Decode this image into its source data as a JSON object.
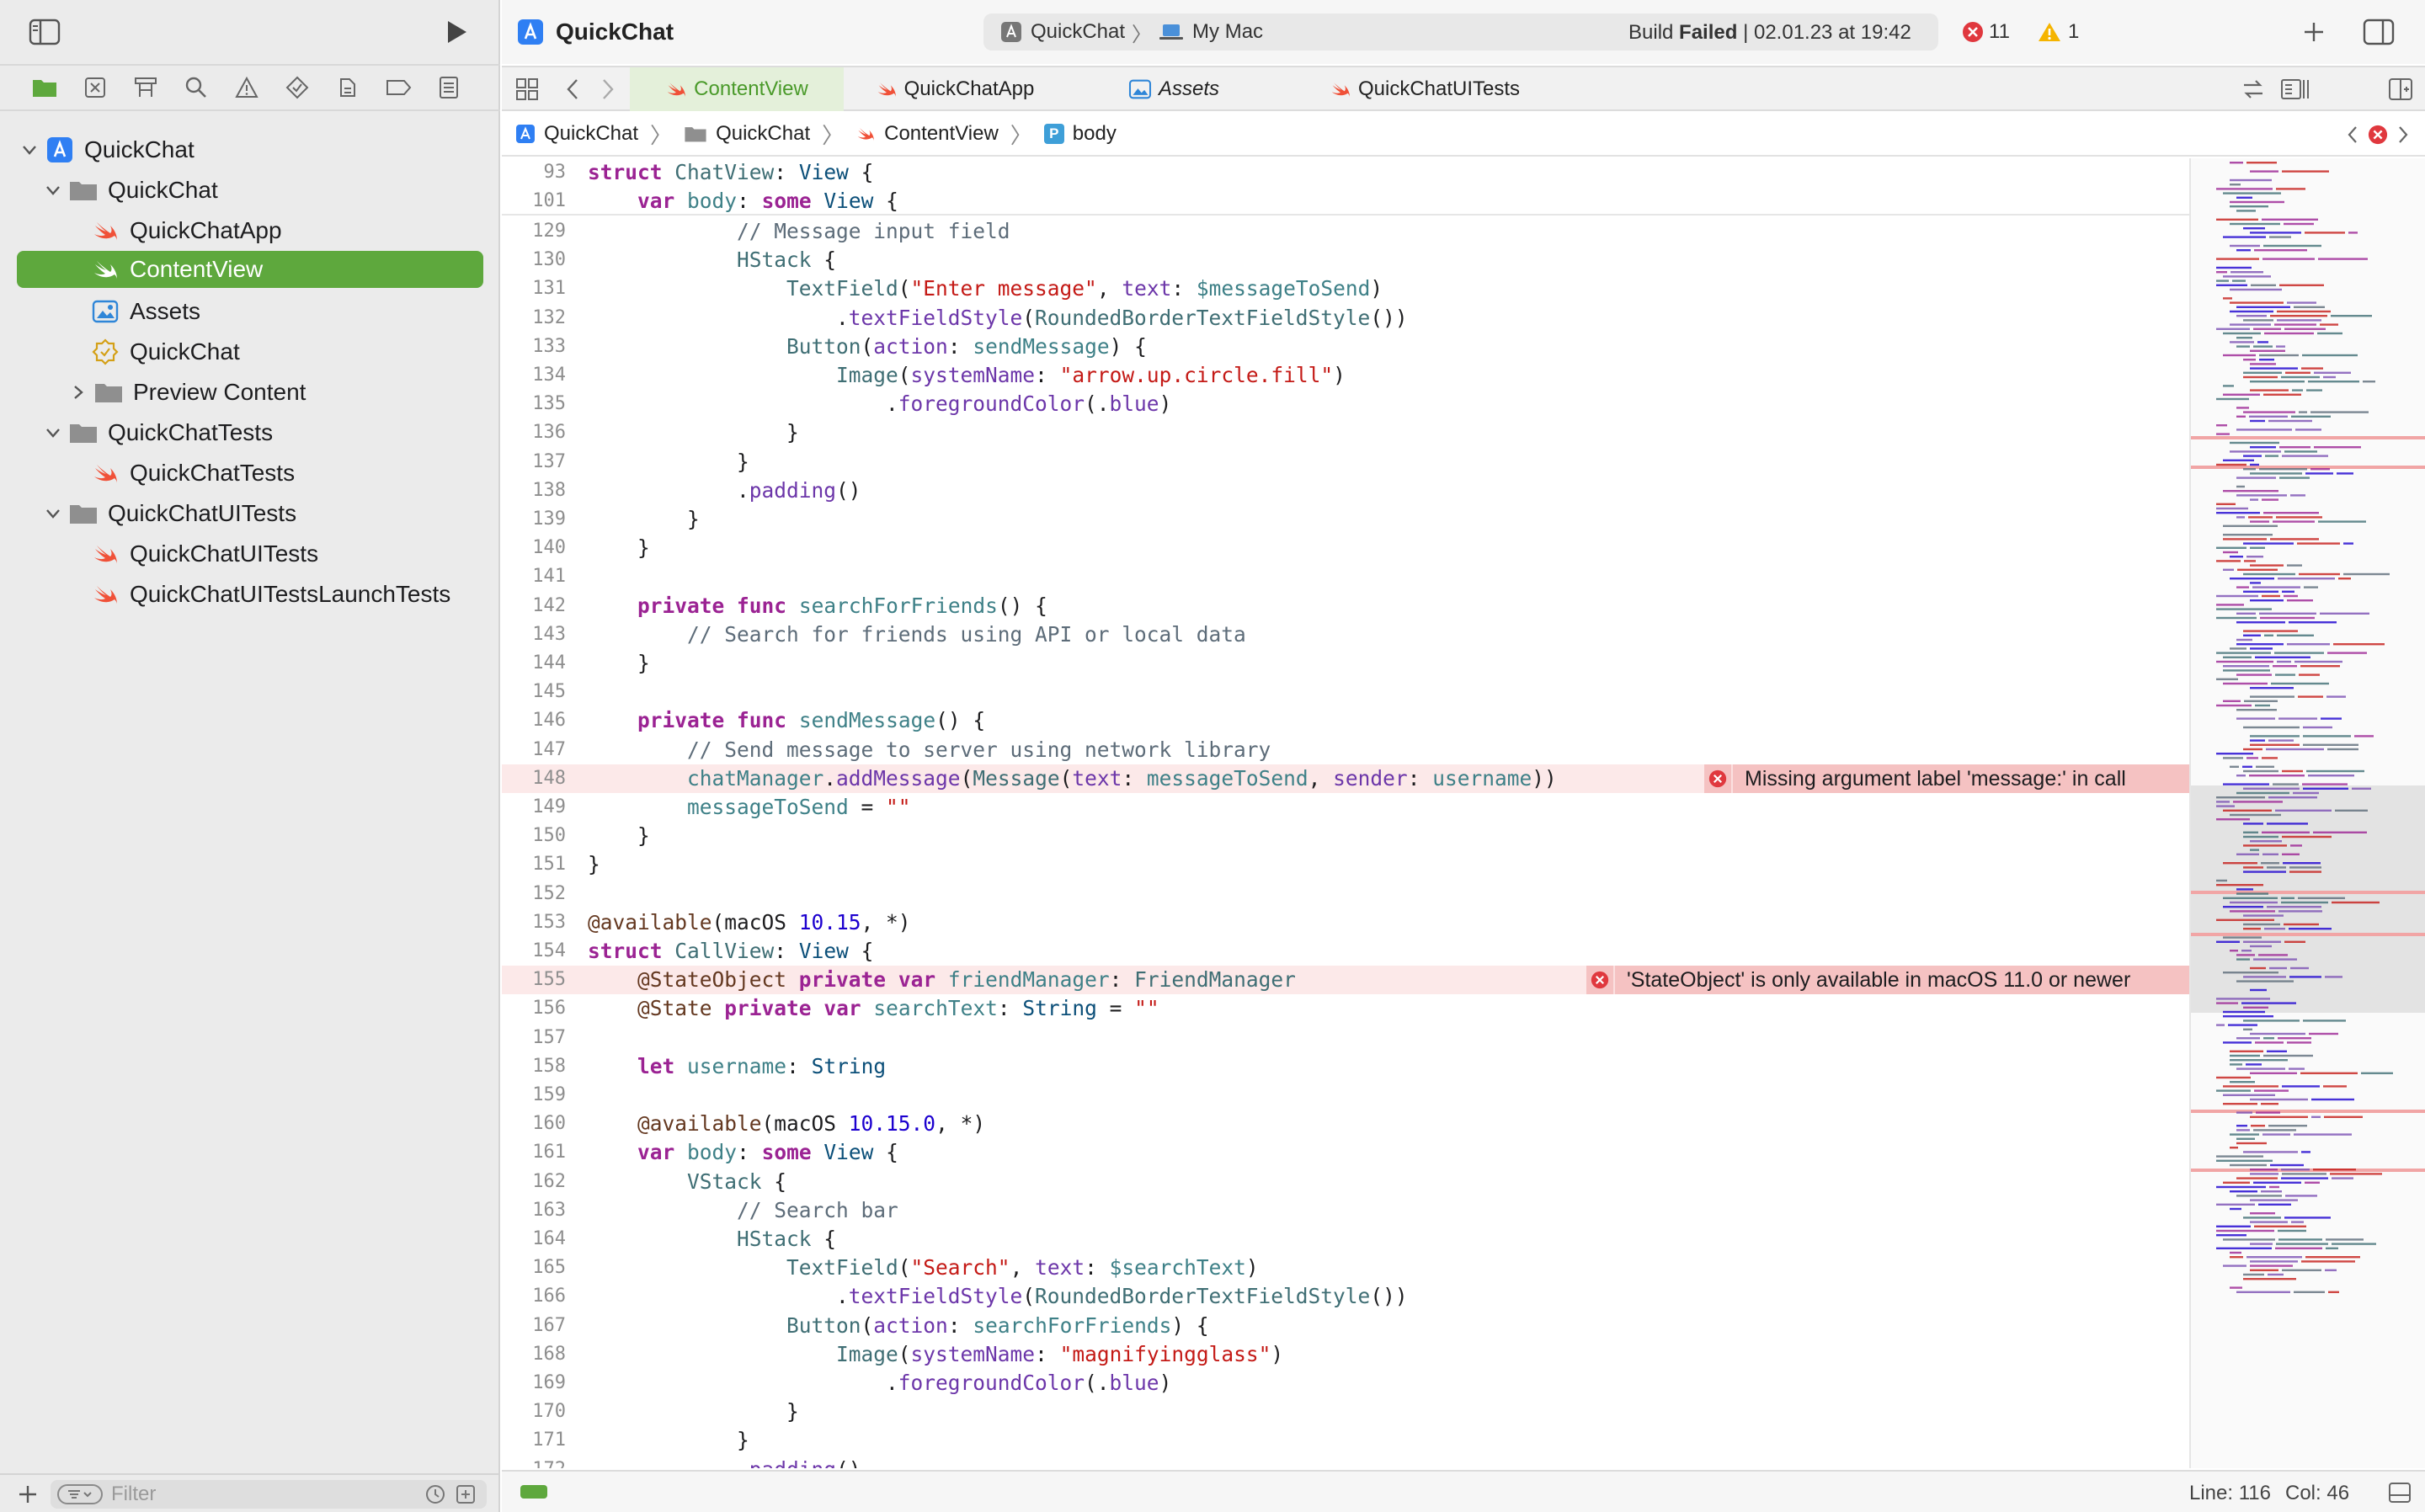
{
  "window": {
    "title": "QuickChat"
  },
  "scheme": {
    "project": "QuickChat",
    "destination": "My Mac",
    "build_prefix": "Build",
    "build_result": "Failed",
    "build_time": "| 02.01.23 at 19:42",
    "errors": "11",
    "warnings": "1"
  },
  "tabs": [
    {
      "label": "ContentView",
      "active": true
    },
    {
      "label": "QuickChatApp",
      "active": false
    },
    {
      "label": "Assets",
      "active": false
    },
    {
      "label": "QuickChatUITests",
      "active": false
    }
  ],
  "breadcrumb": [
    "QuickChat",
    "QuickChat",
    "ContentView",
    "body"
  ],
  "navigator": {
    "items": [
      {
        "label": "QuickChat",
        "kind": "project"
      },
      {
        "label": "QuickChat",
        "kind": "folder"
      },
      {
        "label": "QuickChatApp",
        "kind": "swift"
      },
      {
        "label": "ContentView",
        "kind": "swift",
        "selected": true
      },
      {
        "label": "Assets",
        "kind": "assets"
      },
      {
        "label": "QuickChat",
        "kind": "entitlements"
      },
      {
        "label": "Preview Content",
        "kind": "folder"
      },
      {
        "label": "QuickChatTests",
        "kind": "folder"
      },
      {
        "label": "QuickChatTests",
        "kind": "swift"
      },
      {
        "label": "QuickChatUITests",
        "kind": "folder"
      },
      {
        "label": "QuickChatUITests",
        "kind": "swift"
      },
      {
        "label": "QuickChatUITestsLaunchTests",
        "kind": "swift"
      }
    ],
    "filter_placeholder": "Filter"
  },
  "sticky": [
    {
      "n": "93",
      "text": "struct ChatView: View {"
    },
    {
      "n": "101",
      "text": "    var body: some View {"
    }
  ],
  "code": [
    {
      "n": "129",
      "text": "            // Message input field"
    },
    {
      "n": "130",
      "text": "            HStack {"
    },
    {
      "n": "131",
      "text": "                TextField(\"Enter message\", text: $messageToSend)"
    },
    {
      "n": "132",
      "text": "                    .textFieldStyle(RoundedBorderTextFieldStyle())"
    },
    {
      "n": "133",
      "text": "                Button(action: sendMessage) {"
    },
    {
      "n": "134",
      "text": "                    Image(systemName: \"arrow.up.circle.fill\")"
    },
    {
      "n": "135",
      "text": "                        .foregroundColor(.blue)"
    },
    {
      "n": "136",
      "text": "                }"
    },
    {
      "n": "137",
      "text": "            }"
    },
    {
      "n": "138",
      "text": "            .padding()"
    },
    {
      "n": "139",
      "text": "        }"
    },
    {
      "n": "140",
      "text": "    }"
    },
    {
      "n": "141",
      "text": ""
    },
    {
      "n": "142",
      "text": "    private func searchForFriends() {"
    },
    {
      "n": "143",
      "text": "        // Search for friends using API or local data"
    },
    {
      "n": "144",
      "text": "    }"
    },
    {
      "n": "145",
      "text": ""
    },
    {
      "n": "146",
      "text": "    private func sendMessage() {"
    },
    {
      "n": "147",
      "text": "        // Send message to server using network library"
    },
    {
      "n": "148",
      "text": "        chatManager.addMessage(Message(text: messageToSend, sender: username))"
    },
    {
      "n": "149",
      "text": "        messageToSend = \"\""
    },
    {
      "n": "150",
      "text": "    }"
    },
    {
      "n": "151",
      "text": "}"
    },
    {
      "n": "152",
      "text": ""
    },
    {
      "n": "153",
      "text": "@available(macOS 10.15, *)"
    },
    {
      "n": "154",
      "text": "struct CallView: View {"
    },
    {
      "n": "155",
      "text": "    @StateObject private var friendManager: FriendManager"
    },
    {
      "n": "156",
      "text": "    @State private var searchText: String = \"\""
    },
    {
      "n": "157",
      "text": ""
    },
    {
      "n": "158",
      "text": "    let username: String"
    },
    {
      "n": "159",
      "text": ""
    },
    {
      "n": "160",
      "text": "    @available(macOS 10.15.0, *)"
    },
    {
      "n": "161",
      "text": "    var body: some View {"
    },
    {
      "n": "162",
      "text": "        VStack {"
    },
    {
      "n": "163",
      "text": "            // Search bar"
    },
    {
      "n": "164",
      "text": "            HStack {"
    },
    {
      "n": "165",
      "text": "                TextField(\"Search\", text: $searchText)"
    },
    {
      "n": "166",
      "text": "                    .textFieldStyle(RoundedBorderTextFieldStyle())"
    },
    {
      "n": "167",
      "text": "                Button(action: searchForFriends) {"
    },
    {
      "n": "168",
      "text": "                    Image(systemName: \"magnifyingglass\")"
    },
    {
      "n": "169",
      "text": "                        .foregroundColor(.blue)"
    },
    {
      "n": "170",
      "text": "                }"
    },
    {
      "n": "171",
      "text": "            }"
    },
    {
      "n": "172",
      "text": "            .padding()"
    }
  ],
  "errors": [
    {
      "line": "148",
      "message": "Missing argument label 'message:' in call"
    },
    {
      "line": "155",
      "message": "'StateObject' is only available in macOS 11.0 or newer"
    }
  ],
  "status": {
    "line": "Line: 116",
    "col": "Col: 46"
  },
  "colors": {
    "accent_green": "#5ea83d",
    "error_red": "#e0383e",
    "warning_yellow": "#f5b400"
  }
}
